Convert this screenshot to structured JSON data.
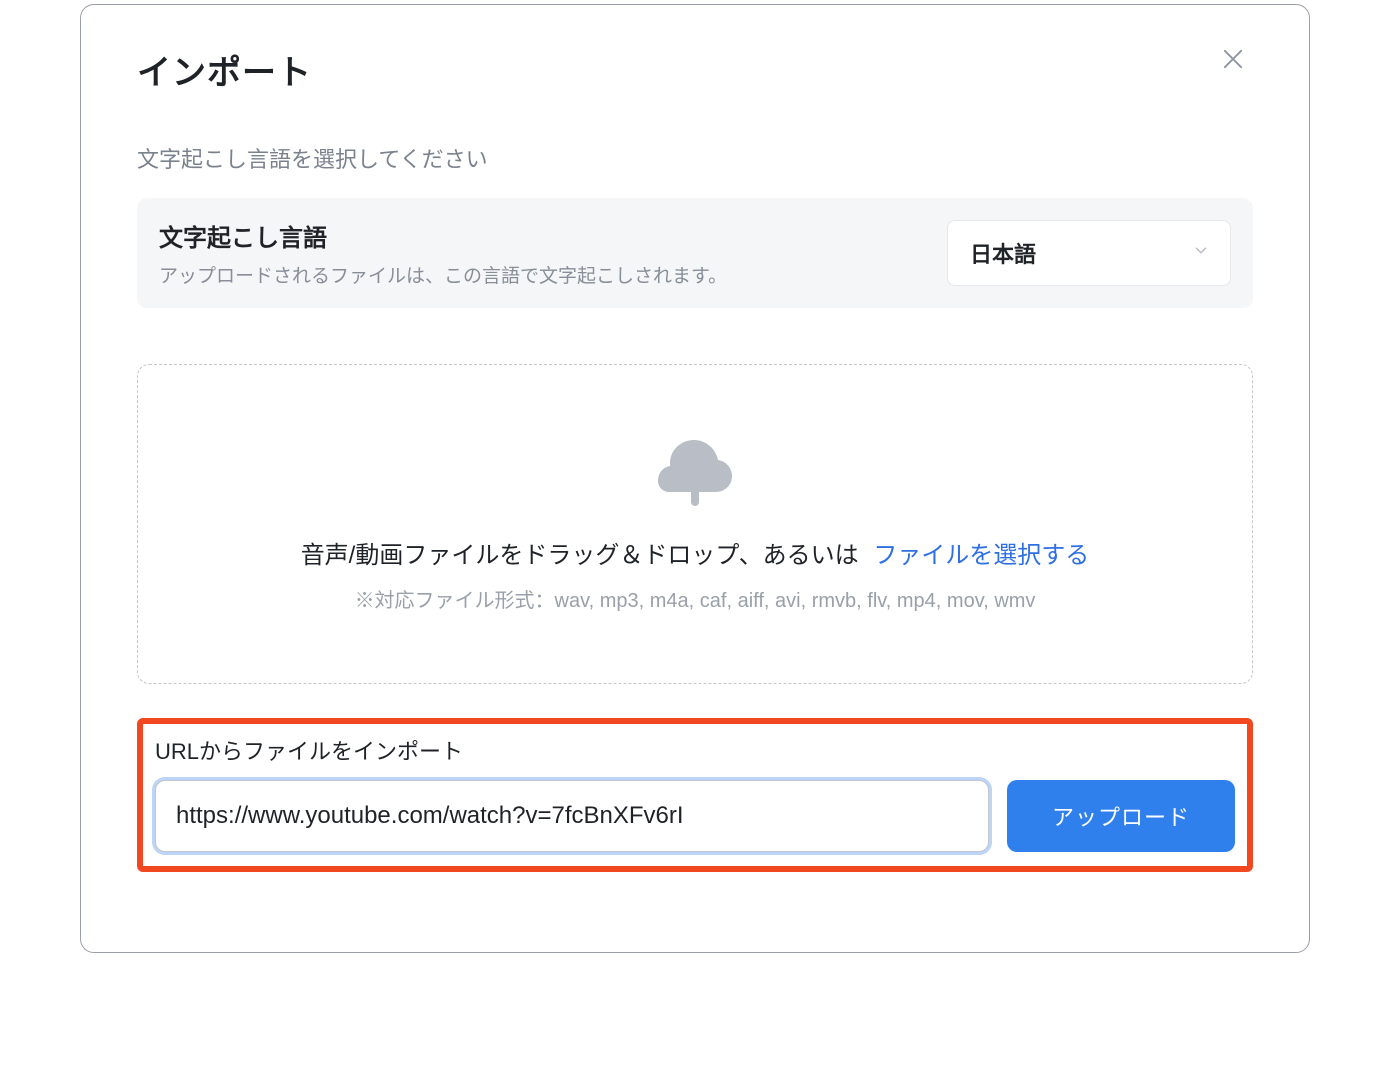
{
  "modal": {
    "title": "インポート",
    "subtitle": "文字起こし言語を選択してください"
  },
  "language_card": {
    "title": "文字起こし言語",
    "description": "アップロードされるファイルは、この言語で文字起こしされます。",
    "selected": "日本語"
  },
  "dropzone": {
    "text_prefix": "音声/動画ファイルをドラッグ＆ドロップ、あるいは ",
    "link_text": "ファイルを選択する",
    "formats": "※対応ファイル形式：wav, mp3, m4a, caf, aiff, avi, rmvb, flv, mp4, mov, wmv"
  },
  "url_section": {
    "label": "URLからファイルをインポート",
    "input_value": "https://www.youtube.com/watch?v=7fcBnXFv6rI",
    "button_label": "アップロード"
  }
}
